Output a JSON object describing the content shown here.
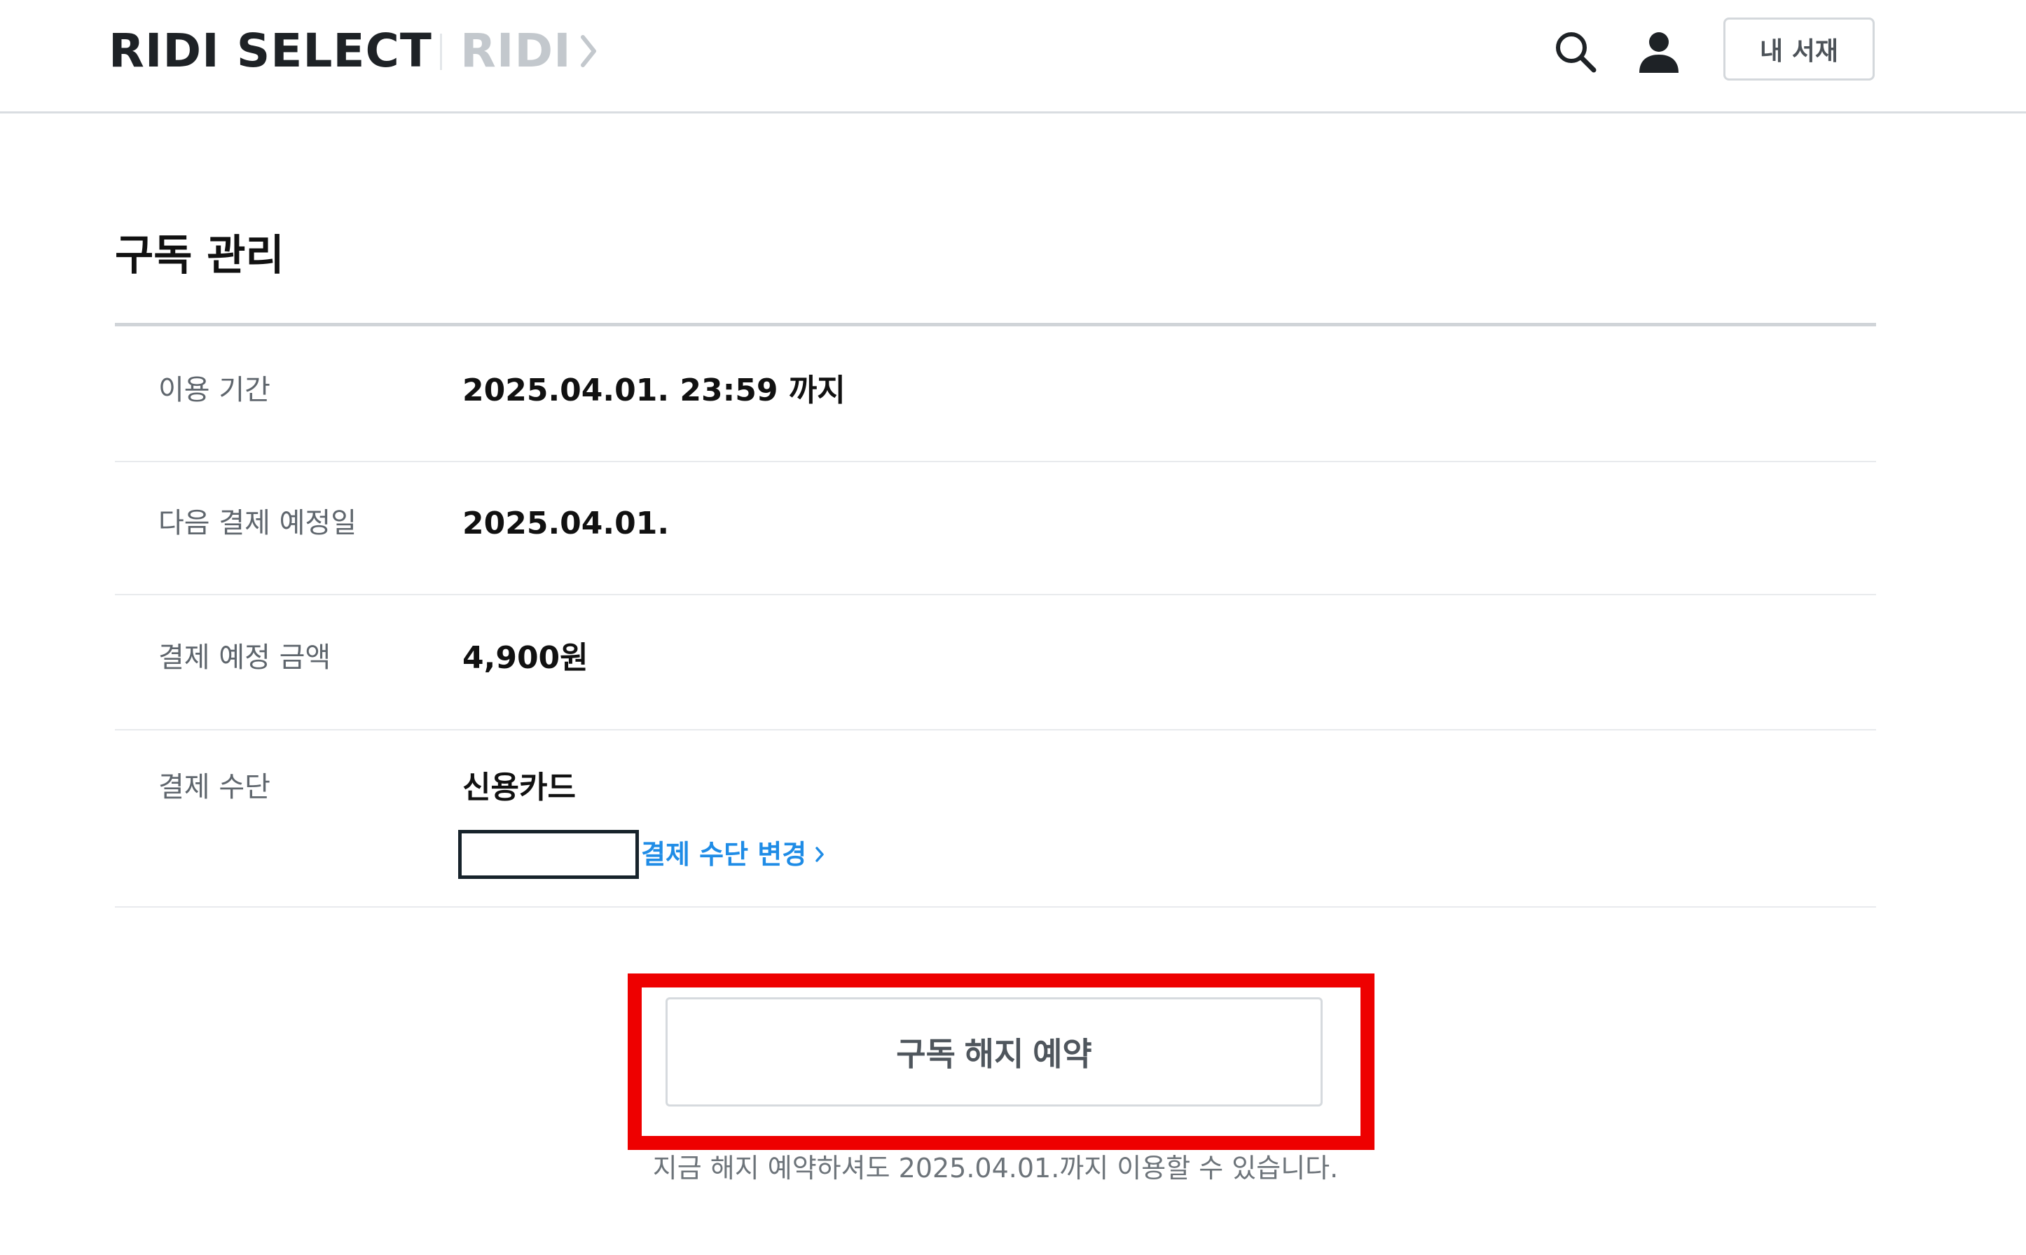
{
  "header": {
    "logo_text": "RIDI SELECT",
    "ridi_link_label": "RIDI",
    "library_button_label": "내 서재"
  },
  "icons": {
    "search": "search-icon",
    "user": "user-icon",
    "ridi_chevron": "chevron-right-icon",
    "link_chevron": "chevron-right-icon"
  },
  "page": {
    "title": "구독 관리"
  },
  "subscription": {
    "period": {
      "label": "이용 기간",
      "value": "2025.04.01. 23:59 까지"
    },
    "next_payment": {
      "label": "다음 결제 예정일",
      "value": "2025.04.01."
    },
    "amount": {
      "label": "결제 예정 금액",
      "value": "4,900원"
    },
    "method": {
      "label": "결제 수단",
      "value": "신용카드",
      "change_link": "결제 수단 변경"
    }
  },
  "cancel": {
    "button_label": "구독 해지 예약",
    "note": "지금 해지 예약하셔도 2025.04.01.까지 이용할 수 있습니다."
  },
  "colors": {
    "accent_link": "#1f8ce6",
    "highlight": "#ee0000",
    "logo": "#1e2226",
    "ridi_link": "#c3c8cd"
  }
}
